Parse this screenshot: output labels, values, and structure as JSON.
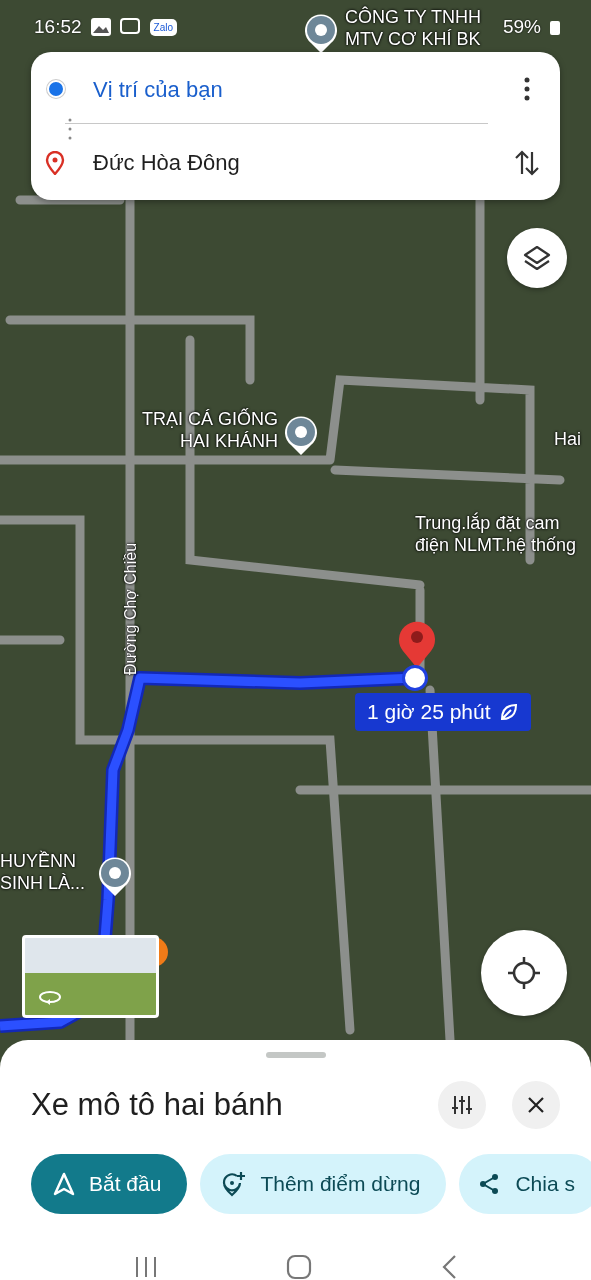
{
  "status_bar": {
    "time": "16:52",
    "notification_badge": "Zalo",
    "battery": "59%"
  },
  "directions": {
    "origin": "Vị trí của bạn",
    "destination": "Đức Hòa Đông"
  },
  "map": {
    "places": [
      {
        "name": "CÔNG TY TNHH\nMTV CƠ KHÍ BK",
        "kind": "pin"
      },
      {
        "name": "TRẠI CÁ GIỐNG\nHAI KHÁNH",
        "kind": "pin"
      },
      {
        "name": "Hai",
        "kind": "label"
      },
      {
        "name": "Trung.lắp đặt cam\nđiện NLMT.hệ thống",
        "kind": "label"
      },
      {
        "name": "HUYỀNN\nSINH LÀ...",
        "kind": "pin"
      }
    ],
    "road_name": "Đường Chợ Chiều",
    "route_duration": "1 giờ 25 phút"
  },
  "sheet": {
    "mode": "Xe mô tô hai bánh",
    "actions": [
      {
        "label": "Bắt đầu",
        "kind": "start"
      },
      {
        "label": "Thêm điểm dừng",
        "kind": "add-stop"
      },
      {
        "label": "Chia s",
        "kind": "share"
      }
    ]
  }
}
